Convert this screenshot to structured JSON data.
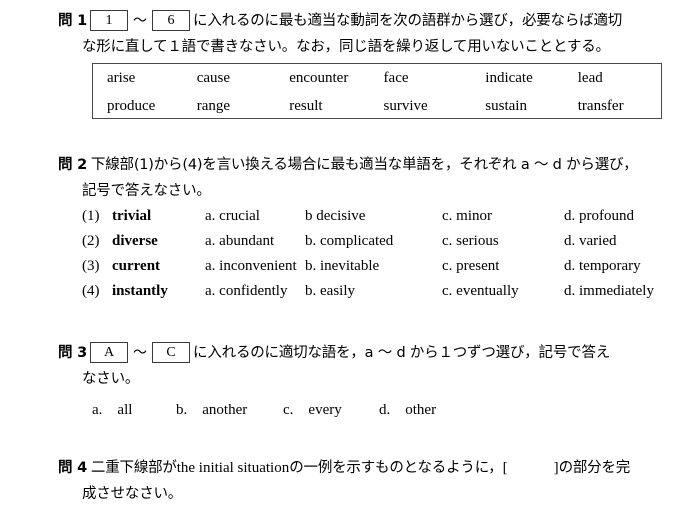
{
  "q1": {
    "label": "問 1",
    "blank_start": "1",
    "blank_end": "6",
    "tilde": "〜",
    "line1_text": "に入れるのに最も適当な動詞を次の語群から選び，必要ならば適切",
    "line2_text": "な形に直して１語で書きなさい。なお，同じ語を繰り返して用いないこととする。",
    "word_bank": {
      "row1": [
        "arise",
        "cause",
        "encounter",
        "face",
        "indicate",
        "lead"
      ],
      "row2": [
        "produce",
        "range",
        "result",
        "survive",
        "sustain",
        "transfer"
      ]
    }
  },
  "q2": {
    "label": "問 2",
    "line1_text": "下線部(1)から(4)を言い換える場合に最も適当な単語を，それぞれ a 〜 d から選び，",
    "line2_text": "記号で答えなさい。",
    "items": [
      {
        "number": "(1)",
        "headword": "trivial",
        "options": [
          "a. crucial",
          "b decisive",
          "c. minor",
          "d. profound"
        ]
      },
      {
        "number": "(2)",
        "headword": "diverse",
        "options": [
          "a. abundant",
          "b. complicated",
          "c. serious",
          "d. varied"
        ]
      },
      {
        "number": "(3)",
        "headword": "current",
        "options": [
          "a. inconvenient",
          "b. inevitable",
          "c. present",
          "d. temporary"
        ]
      },
      {
        "number": "(4)",
        "headword": "instantly",
        "options": [
          "a. confidently",
          "b. easily",
          "c. eventually",
          "d. immediately"
        ]
      }
    ]
  },
  "q3": {
    "label": "問 3",
    "blank_start": "A",
    "blank_end": "C",
    "tilde": "〜",
    "line1_text": "に入れるのに適切な語を，a 〜 d から１つずつ選び，記号で答え",
    "line2_text": "なさい。",
    "options": [
      "a.　all",
      "b.　another",
      "c.　every",
      "d.　other"
    ]
  },
  "q4": {
    "label": "問 4",
    "text_before": "二重下線部が",
    "english_phrase": "the initial situation",
    "text_middle": "の一例を示すものとなるように，",
    "bracket_open": "[",
    "bracket_close": "]",
    "text_after": "の部分を完",
    "line2_text": "成させなさい。"
  }
}
